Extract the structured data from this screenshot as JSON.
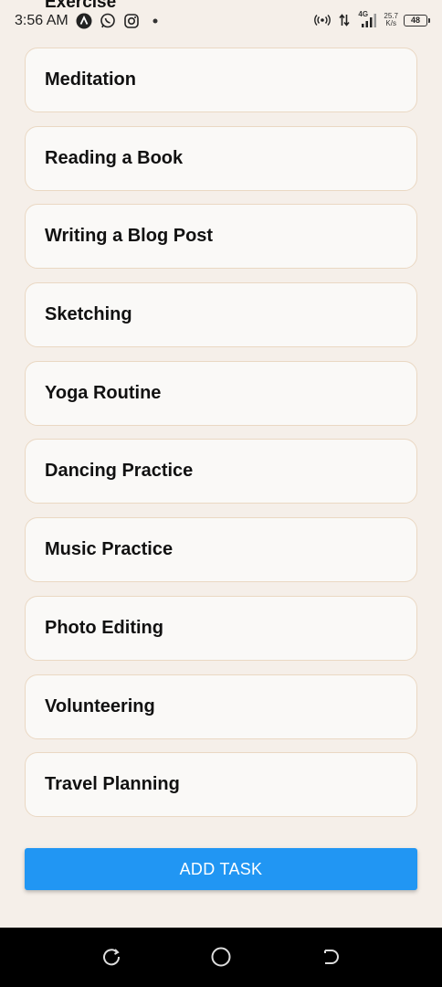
{
  "status_bar": {
    "time": "3:56 AM",
    "network_type": "4G",
    "speed_value": "25.7",
    "speed_unit": "K/s",
    "battery": "48",
    "icons": [
      "a-app-icon",
      "whatsapp-icon",
      "instagram-icon",
      "dot-icon",
      "hotspot-icon",
      "data-arrows-icon",
      "signal-icon",
      "battery-icon"
    ]
  },
  "list": {
    "partial_top_item": "Exercise",
    "items": [
      {
        "label": "Meditation"
      },
      {
        "label": "Reading a Book"
      },
      {
        "label": "Writing a Blog Post"
      },
      {
        "label": "Sketching"
      },
      {
        "label": "Yoga Routine"
      },
      {
        "label": "Dancing Practice"
      },
      {
        "label": "Music Practice"
      },
      {
        "label": "Photo Editing"
      },
      {
        "label": "Volunteering"
      },
      {
        "label": "Travel Planning"
      }
    ]
  },
  "add_button": {
    "label": "ADD TASK"
  },
  "nav_bar": {
    "icons": [
      "recent-apps-icon",
      "home-icon",
      "back-icon"
    ]
  },
  "colors": {
    "background": "#f5efe9",
    "card_background": "#faf9f7",
    "card_border": "#ead8c3",
    "accent": "#2196f3",
    "nav_background": "#000000"
  }
}
